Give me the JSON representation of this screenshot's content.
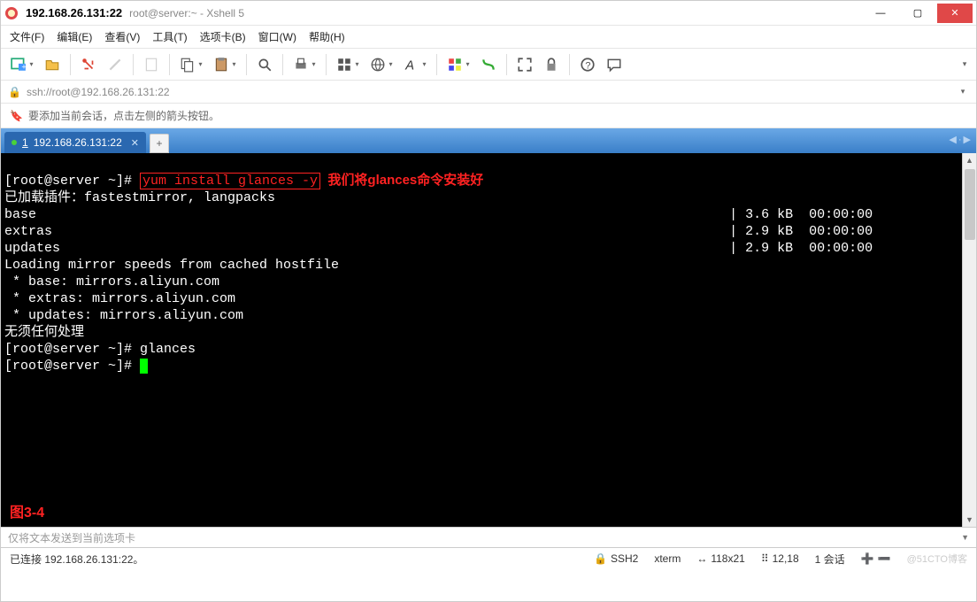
{
  "window": {
    "title": "192.168.26.131:22",
    "subtitle": "root@server:~ - Xshell 5"
  },
  "menu": {
    "file": "文件(F)",
    "edit": "编辑(E)",
    "view": "查看(V)",
    "tools": "工具(T)",
    "tabs": "选项卡(B)",
    "window": "窗口(W)",
    "help": "帮助(H)"
  },
  "addressbar": "ssh://root@192.168.26.131:22",
  "infobar": "要添加当前会话，点击左侧的箭头按钮。",
  "tab": {
    "index": "1",
    "label": "192.168.26.131:22"
  },
  "terminal": {
    "prompt1_prefix": "[root@server ~]# ",
    "cmd_highlight": "yum install glances -y",
    "annotation": "  我们将glances命令安装好",
    "lines": [
      "已加载插件：fastestmirror, langpacks",
      "base                                                                                       | 3.6 kB  00:00:00",
      "extras                                                                                     | 2.9 kB  00:00:00",
      "updates                                                                                    | 2.9 kB  00:00:00",
      "Loading mirror speeds from cached hostfile",
      " * base: mirrors.aliyun.com",
      " * extras: mirrors.aliyun.com",
      " * updates: mirrors.aliyun.com",
      "无须任何处理",
      "[root@server ~]# glances",
      "[root@server ~]# "
    ],
    "figure_label": "图3-4"
  },
  "inputbar_placeholder": "仅将文本发送到当前选项卡",
  "status": {
    "conn": "已连接 192.168.26.131:22。",
    "proto": "SSH2",
    "term": "xterm",
    "size": "118x21",
    "cursor": "12,18",
    "sessions_label": "1 会话",
    "watermark": "@51CTO博客"
  }
}
